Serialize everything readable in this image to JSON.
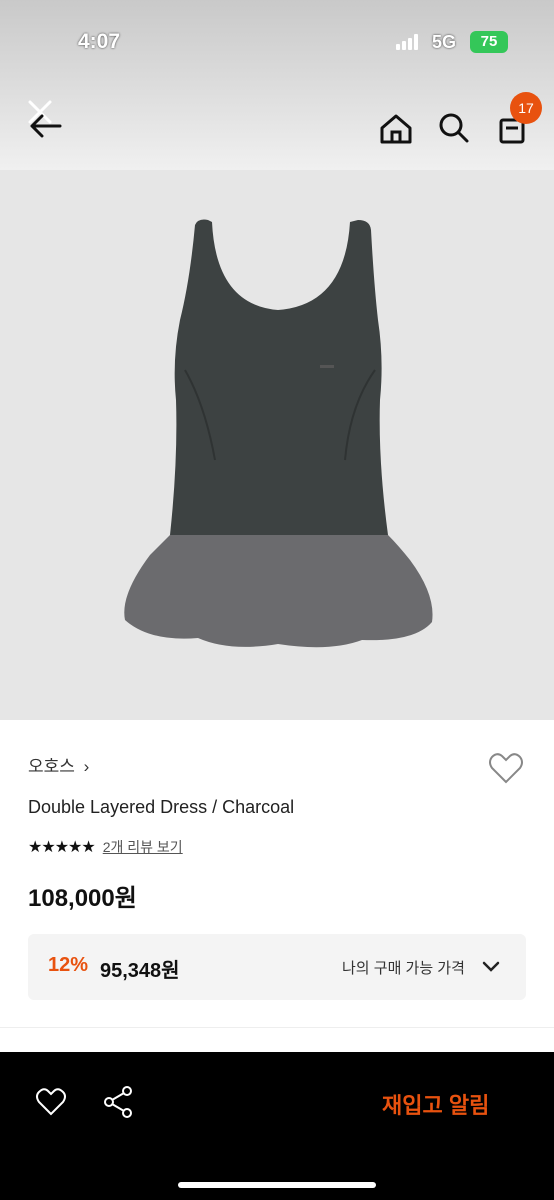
{
  "status_bar": {
    "time": "4:07",
    "network": "5G",
    "battery": "75"
  },
  "header": {
    "icons": [
      "close-icon",
      "back-arrow-icon",
      "home-icon",
      "search-icon",
      "cart-icon"
    ],
    "cart_count": "17"
  },
  "product": {
    "image_alt": "dress-photo",
    "brand": "오호스",
    "brand_chevron": "›",
    "name": "Double Layered Dress / Charcoal",
    "stars": "★★★★★",
    "rating_value": 4.5,
    "review_link": "2개 리뷰 보기",
    "price": "108,000원"
  },
  "discount": {
    "rate": "12%",
    "price": "95,348원",
    "label": "나의 구매 가능 가격"
  },
  "bottom_bar": {
    "icons": [
      "heart-icon",
      "share-icon"
    ],
    "cta": "재입고 알림"
  },
  "colors": {
    "accent": "#e8520f",
    "dress_body": "#3d4242",
    "dress_skirt": "#6b6b6e"
  }
}
